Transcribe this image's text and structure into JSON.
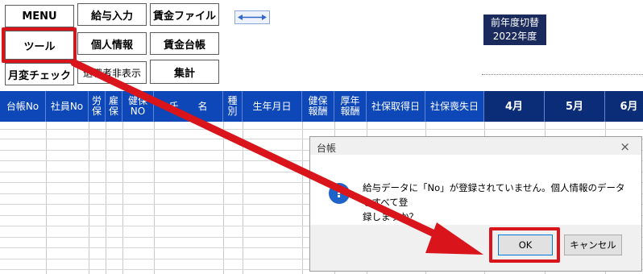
{
  "menu": {
    "menu": "MENU",
    "kyuyo_nyuryoku": "給与入力",
    "chingin_file": "賃金ファイル",
    "tool": "ツール",
    "kojin_joho": "個人情報",
    "chingin_daicho": "賃金台帳",
    "getsuhen_check": "月変チェック",
    "taishoku_hihyoji": "退職者非表示",
    "shukei": "集計"
  },
  "year_switch": {
    "line1": "前年度切替",
    "line2": "2022年度"
  },
  "columns": [
    {
      "label": "台帳No"
    },
    {
      "label": "社員No"
    },
    {
      "label": "労\n保"
    },
    {
      "label": "雇\n保"
    },
    {
      "label": "健保\nNO"
    },
    {
      "label": "氏　　名"
    },
    {
      "label": "種\n別"
    },
    {
      "label": "生年月日"
    },
    {
      "label": "健保\n報酬"
    },
    {
      "label": "厚年\n報酬"
    },
    {
      "label": "社保取得日"
    },
    {
      "label": "社保喪失日"
    },
    {
      "label": "4月"
    },
    {
      "label": "5月"
    },
    {
      "label": "6月"
    }
  ],
  "dialog": {
    "title": "台帳",
    "close": "×",
    "icon": "?",
    "message_line1": "給与データに「No」が登録されていません。個人情報のデータをすべて登",
    "message_line2": "録しますか？",
    "ok": "OK",
    "cancel": "キャンセル"
  },
  "accent_colors": {
    "header": "#0d47b8",
    "header_dark": "#0b2c77",
    "highlight": "#d9141b"
  }
}
